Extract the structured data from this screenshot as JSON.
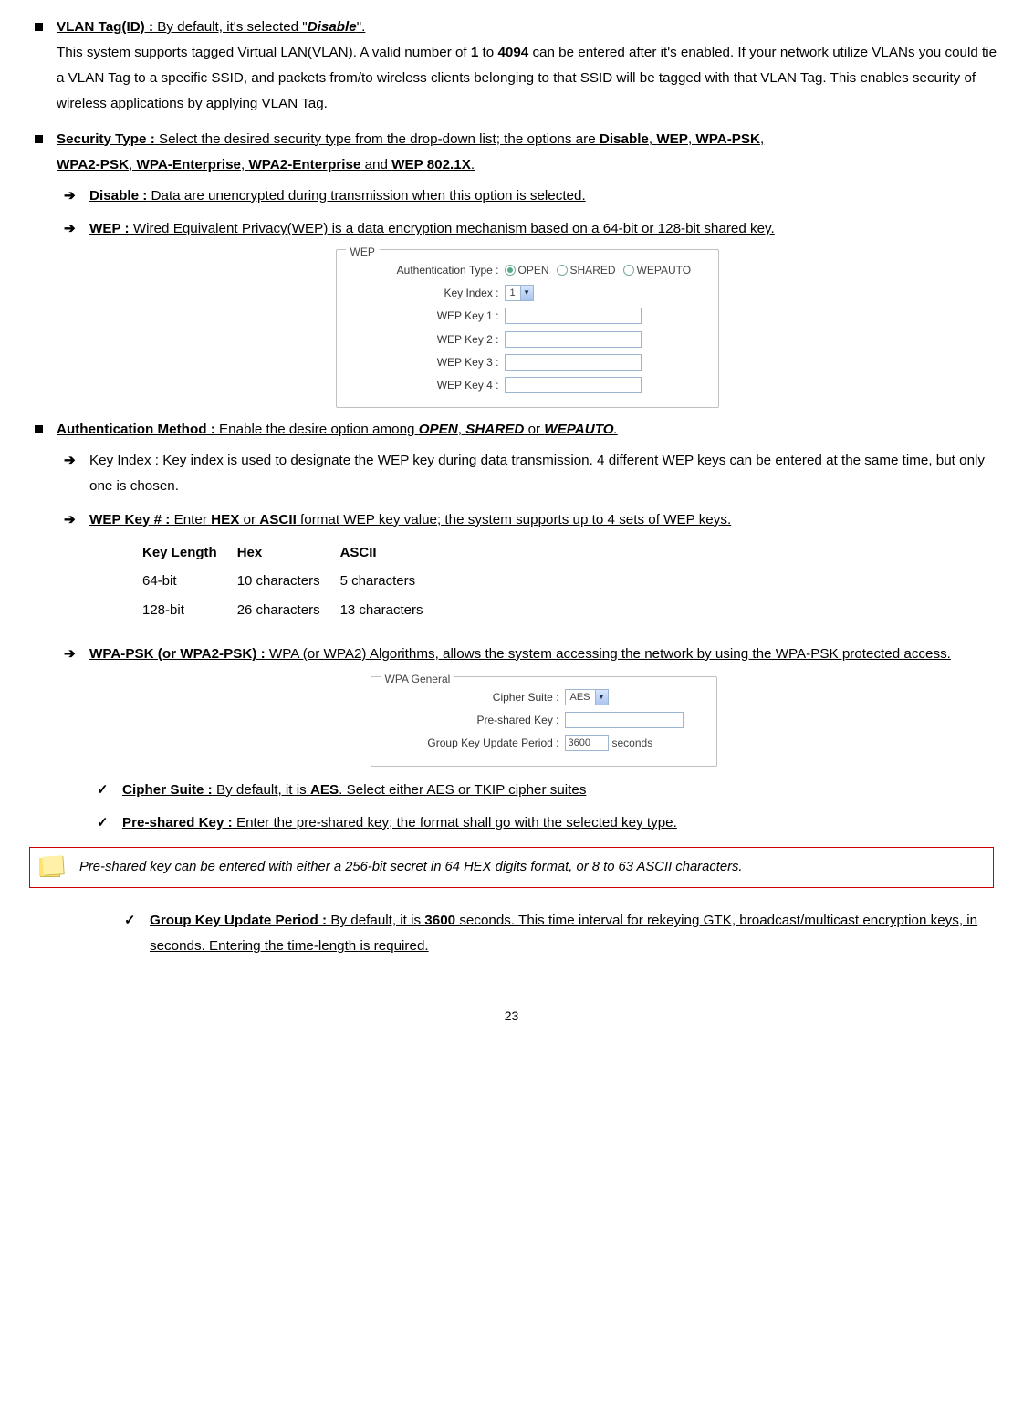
{
  "page_number": "23",
  "bullets": {
    "vlan_head": "VLAN Tag(ID) :",
    "vlan_head_rest": " By default, it's selected \"",
    "vlan_head_em": "Disable",
    "vlan_head_close": "\".",
    "vlan_body_a": "This system supports tagged Virtual LAN(VLAN). A valid number of ",
    "vlan_one": "1",
    "vlan_to": " to ",
    "vlan_4094": "4094",
    "vlan_body_b": " can be entered after it's enabled. If your network utilize VLANs you could tie a VLAN Tag to a specific SSID, and packets from/to wireless clients belonging to that SSID will be tagged with that VLAN Tag. This enables security of wireless applications by applying VLAN Tag.",
    "sec_head": "Security Type :",
    "sec_rest": " Select the desired security type from the drop-down list; the options are ",
    "sec_disable": "Disable",
    "sec_c1": ", ",
    "sec_wep": "WEP",
    "sec_c2": ", ",
    "sec_wpapsk": "WPA-PSK",
    "sec_c3": ", ",
    "sec_wpa2psk": "WPA2-PSK",
    "sec_c4": ", ",
    "sec_wpae": "WPA-Enterprise",
    "sec_c5": ", ",
    "sec_wpa2e": "WPA2-Enterprise",
    "sec_and": " and ",
    "sec_wep1x": "WEP 802.1X",
    "sec_dot": ".",
    "disable_head": "Disable :",
    "disable_rest": " Data are unencrypted during transmission when this option is selected.",
    "wep_head": "WEP :",
    "wep_rest": " Wired Equivalent Privacy(WEP) is a data encryption mechanism based on a 64-bit or 128-bit shared key.",
    "auth_head": "Authentication Method :",
    "auth_rest_a": " Enable the desire option among ",
    "auth_open": "OPEN",
    "auth_c1": ", ",
    "auth_shared": "SHARED",
    "auth_or": " or ",
    "auth_wepauto": "WEPAUTO",
    "auth_dot": ".",
    "keyidx_head": "Key Index :",
    "keyidx_rest": "   Key index is used to designate the WEP key during data transmission. 4 different WEP keys can be entered at the same time, but only one is chosen.",
    "wepk_head": "WEP Key # :",
    "wepk_rest_a": " Enter ",
    "wepk_hex": "HEX",
    "wepk_or": " or ",
    "wepk_ascii": "ASCII",
    "wepk_rest_b": " format WEP key value; the system supports up to 4 sets of WEP keys.",
    "wpapsk_head": "WPA-PSK (or WPA2-PSK) :",
    "wpapsk_rest": " WPA (or WPA2) Algorithms, allows the system accessing the network by using the WPA-PSK protected access.",
    "cipher_head": "Cipher Suite :",
    "cipher_rest_a": " By default, it is ",
    "cipher_aes": "AES",
    "cipher_rest_b": ". Select either AES or TKIP cipher suites",
    "psk_head": "Pre-shared Key :",
    "psk_rest": " Enter the pre-shared key; the format shall go with the selected key type.",
    "note_text": "Pre-shared key can be entered with either a 256-bit secret in 64 HEX digits format, or 8 to 63 ASCII characters.",
    "gkup_head": "Group Key Update Period :",
    "gkup_rest_a": " By default, it is ",
    "gkup_3600": "3600",
    "gkup_rest_b": " seconds. This time interval for rekeying GTK, broadcast/multicast encryption keys, in seconds. Entering the time-length is required."
  },
  "wep_panel": {
    "legend": "WEP",
    "auth_label": "Authentication Type :",
    "opt_open": "OPEN",
    "opt_shared": "SHARED",
    "opt_wepauto": "WEPAUTO",
    "keyidx_label": "Key Index :",
    "keyidx_value": "1",
    "k1": "WEP Key 1 :",
    "k2": "WEP Key 2 :",
    "k3": "WEP Key 3 :",
    "k4": "WEP Key 4 :"
  },
  "wep_table": {
    "h1": "Key Length",
    "h2": "Hex",
    "h3": "ASCII",
    "r1c1": "64-bit",
    "r1c2": "10 characters",
    "r1c3": "5 characters",
    "r2c1": "128-bit",
    "r2c2": "26 characters",
    "r2c3": "13 characters"
  },
  "wpa_panel": {
    "legend": "WPA General",
    "cipher_label": "Cipher Suite :",
    "cipher_value": "AES",
    "psk_label": "Pre-shared Key :",
    "gk_label": "Group Key Update Period :",
    "gk_value": "3600",
    "gk_unit": "seconds"
  }
}
